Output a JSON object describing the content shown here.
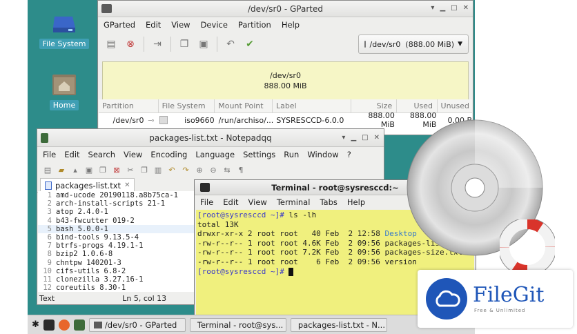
{
  "desktop": {
    "icons": [
      {
        "label": "File System",
        "icon": "drive-icon"
      },
      {
        "label": "Home",
        "icon": "home-folder-icon"
      }
    ]
  },
  "gparted": {
    "title": "/dev/sr0 - GParted",
    "menu": [
      "GParted",
      "Edit",
      "View",
      "Device",
      "Partition",
      "Help"
    ],
    "device_selector": "/dev/sr0  (888.00 MiB)",
    "disk_map": {
      "device": "/dev/sr0",
      "size": "888.00 MiB"
    },
    "table": {
      "headers": [
        "Partition",
        "File System",
        "Mount Point",
        "Label",
        "Size",
        "Used",
        "Unused"
      ],
      "rows": [
        {
          "partition": "/dev/sr0",
          "filesystem": "iso9660",
          "mount_point": "/run/archiso/...",
          "label": "SYSRESCCD-6.0.0",
          "size": "888.00 MiB",
          "used": "888.00 MiB",
          "unused": "0.00 B"
        }
      ]
    }
  },
  "notepadqq": {
    "title": "packages-list.txt - Notepadqq",
    "menu": [
      "File",
      "Edit",
      "Search",
      "View",
      "Encoding",
      "Language",
      "Settings",
      "Run",
      "Window",
      "?"
    ],
    "tab_label": "packages-list.txt",
    "lines": [
      {
        "n": "1",
        "text": "amd-ucode 20190118.a8b75ca-1"
      },
      {
        "n": "2",
        "text": "arch-install-scripts 21-1"
      },
      {
        "n": "3",
        "text": "atop 2.4.0-1"
      },
      {
        "n": "4",
        "text": "b43-fwcutter 019-2"
      },
      {
        "n": "5",
        "text": "bash 5.0.0-1"
      },
      {
        "n": "6",
        "text": "bind-tools 9.13.5-4"
      },
      {
        "n": "7",
        "text": "btrfs-progs 4.19.1-1"
      },
      {
        "n": "8",
        "text": "bzip2 1.0.6-8"
      },
      {
        "n": "9",
        "text": "chntpw 140201-3"
      },
      {
        "n": "10",
        "text": "cifs-utils 6.8-2"
      },
      {
        "n": "11",
        "text": "clonezilla 3.27.16-1"
      },
      {
        "n": "12",
        "text": "coreutils 8.30-1"
      }
    ],
    "status_mode": "Text",
    "status_position": "Ln 5, col 13"
  },
  "terminal": {
    "title": "Terminal - root@sysresccd:~",
    "menu": [
      "File",
      "Edit",
      "View",
      "Terminal",
      "Tabs",
      "Help"
    ],
    "prompt": "[root@sysresccd ~]#",
    "command": " ls -lh",
    "output": [
      {
        "prefix": "total 13K",
        "name": "",
        "dir": false
      },
      {
        "prefix": "drwxr-xr-x 2 root root   40 Feb  2 12:58 ",
        "name": "Desktop",
        "dir": true
      },
      {
        "prefix": "-rw-r--r-- 1 root root 4.6K Feb  2 09:56 ",
        "name": "packages-list.txt",
        "dir": false
      },
      {
        "prefix": "-rw-r--r-- 1 root root 7.2K Feb  2 09:56 ",
        "name": "packages-size.txt",
        "dir": false
      },
      {
        "prefix": "-rw-r--r-- 1 root root    6 Feb  2 09:56 ",
        "name": "version",
        "dir": false
      }
    ],
    "prompt2": "[root@sysresccd ~]#"
  },
  "taskbar": {
    "apps": [
      {
        "label": "/dev/sr0 - GParted"
      },
      {
        "label": "Terminal - root@sys..."
      },
      {
        "label": "packages-list.txt - N..."
      }
    ]
  },
  "logo": {
    "name": "FileGit",
    "tagline": "Free & Unlimited"
  },
  "colors": {
    "desktop": "#2d8c8a",
    "terminal_bg": "#f0f07e",
    "disk_map": "#f6f6c6",
    "brand": "#1f56b8"
  }
}
